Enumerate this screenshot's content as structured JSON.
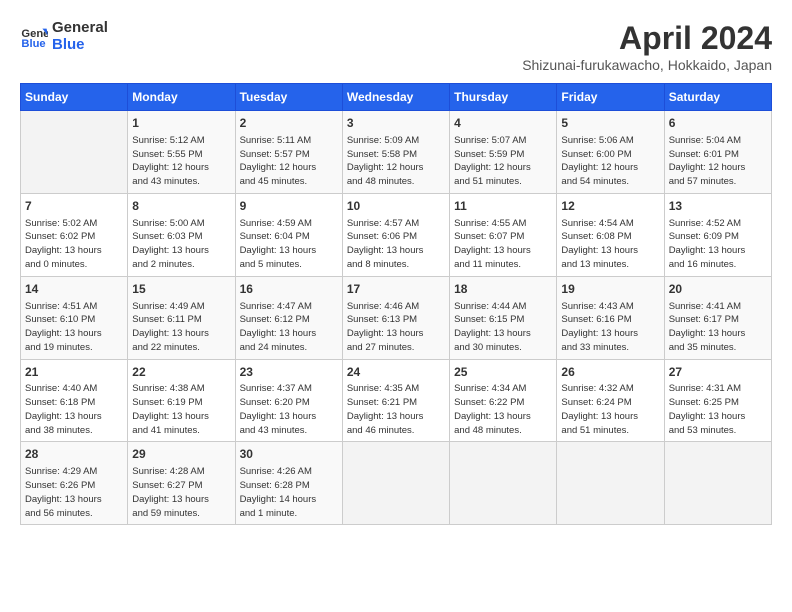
{
  "header": {
    "logo_general": "General",
    "logo_blue": "Blue",
    "month": "April 2024",
    "location": "Shizunai-furukawacho, Hokkaido, Japan"
  },
  "days_of_week": [
    "Sunday",
    "Monday",
    "Tuesday",
    "Wednesday",
    "Thursday",
    "Friday",
    "Saturday"
  ],
  "weeks": [
    [
      {
        "day": "",
        "info": ""
      },
      {
        "day": "1",
        "info": "Sunrise: 5:12 AM\nSunset: 5:55 PM\nDaylight: 12 hours\nand 43 minutes."
      },
      {
        "day": "2",
        "info": "Sunrise: 5:11 AM\nSunset: 5:57 PM\nDaylight: 12 hours\nand 45 minutes."
      },
      {
        "day": "3",
        "info": "Sunrise: 5:09 AM\nSunset: 5:58 PM\nDaylight: 12 hours\nand 48 minutes."
      },
      {
        "day": "4",
        "info": "Sunrise: 5:07 AM\nSunset: 5:59 PM\nDaylight: 12 hours\nand 51 minutes."
      },
      {
        "day": "5",
        "info": "Sunrise: 5:06 AM\nSunset: 6:00 PM\nDaylight: 12 hours\nand 54 minutes."
      },
      {
        "day": "6",
        "info": "Sunrise: 5:04 AM\nSunset: 6:01 PM\nDaylight: 12 hours\nand 57 minutes."
      }
    ],
    [
      {
        "day": "7",
        "info": "Sunrise: 5:02 AM\nSunset: 6:02 PM\nDaylight: 13 hours\nand 0 minutes."
      },
      {
        "day": "8",
        "info": "Sunrise: 5:00 AM\nSunset: 6:03 PM\nDaylight: 13 hours\nand 2 minutes."
      },
      {
        "day": "9",
        "info": "Sunrise: 4:59 AM\nSunset: 6:04 PM\nDaylight: 13 hours\nand 5 minutes."
      },
      {
        "day": "10",
        "info": "Sunrise: 4:57 AM\nSunset: 6:06 PM\nDaylight: 13 hours\nand 8 minutes."
      },
      {
        "day": "11",
        "info": "Sunrise: 4:55 AM\nSunset: 6:07 PM\nDaylight: 13 hours\nand 11 minutes."
      },
      {
        "day": "12",
        "info": "Sunrise: 4:54 AM\nSunset: 6:08 PM\nDaylight: 13 hours\nand 13 minutes."
      },
      {
        "day": "13",
        "info": "Sunrise: 4:52 AM\nSunset: 6:09 PM\nDaylight: 13 hours\nand 16 minutes."
      }
    ],
    [
      {
        "day": "14",
        "info": "Sunrise: 4:51 AM\nSunset: 6:10 PM\nDaylight: 13 hours\nand 19 minutes."
      },
      {
        "day": "15",
        "info": "Sunrise: 4:49 AM\nSunset: 6:11 PM\nDaylight: 13 hours\nand 22 minutes."
      },
      {
        "day": "16",
        "info": "Sunrise: 4:47 AM\nSunset: 6:12 PM\nDaylight: 13 hours\nand 24 minutes."
      },
      {
        "day": "17",
        "info": "Sunrise: 4:46 AM\nSunset: 6:13 PM\nDaylight: 13 hours\nand 27 minutes."
      },
      {
        "day": "18",
        "info": "Sunrise: 4:44 AM\nSunset: 6:15 PM\nDaylight: 13 hours\nand 30 minutes."
      },
      {
        "day": "19",
        "info": "Sunrise: 4:43 AM\nSunset: 6:16 PM\nDaylight: 13 hours\nand 33 minutes."
      },
      {
        "day": "20",
        "info": "Sunrise: 4:41 AM\nSunset: 6:17 PM\nDaylight: 13 hours\nand 35 minutes."
      }
    ],
    [
      {
        "day": "21",
        "info": "Sunrise: 4:40 AM\nSunset: 6:18 PM\nDaylight: 13 hours\nand 38 minutes."
      },
      {
        "day": "22",
        "info": "Sunrise: 4:38 AM\nSunset: 6:19 PM\nDaylight: 13 hours\nand 41 minutes."
      },
      {
        "day": "23",
        "info": "Sunrise: 4:37 AM\nSunset: 6:20 PM\nDaylight: 13 hours\nand 43 minutes."
      },
      {
        "day": "24",
        "info": "Sunrise: 4:35 AM\nSunset: 6:21 PM\nDaylight: 13 hours\nand 46 minutes."
      },
      {
        "day": "25",
        "info": "Sunrise: 4:34 AM\nSunset: 6:22 PM\nDaylight: 13 hours\nand 48 minutes."
      },
      {
        "day": "26",
        "info": "Sunrise: 4:32 AM\nSunset: 6:24 PM\nDaylight: 13 hours\nand 51 minutes."
      },
      {
        "day": "27",
        "info": "Sunrise: 4:31 AM\nSunset: 6:25 PM\nDaylight: 13 hours\nand 53 minutes."
      }
    ],
    [
      {
        "day": "28",
        "info": "Sunrise: 4:29 AM\nSunset: 6:26 PM\nDaylight: 13 hours\nand 56 minutes."
      },
      {
        "day": "29",
        "info": "Sunrise: 4:28 AM\nSunset: 6:27 PM\nDaylight: 13 hours\nand 59 minutes."
      },
      {
        "day": "30",
        "info": "Sunrise: 4:26 AM\nSunset: 6:28 PM\nDaylight: 14 hours\nand 1 minute."
      },
      {
        "day": "",
        "info": ""
      },
      {
        "day": "",
        "info": ""
      },
      {
        "day": "",
        "info": ""
      },
      {
        "day": "",
        "info": ""
      }
    ]
  ]
}
